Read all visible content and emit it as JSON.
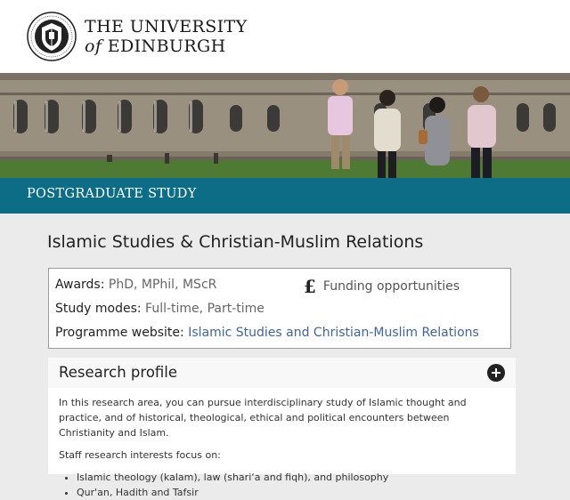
{
  "brand": {
    "line1": "THE UNIVERSITY",
    "line2_of": "of",
    "line2_rest": "EDINBURGH",
    "seal_text": "THE UNIVERSITY OF EDINBURGH"
  },
  "section": {
    "label": "POSTGRADUATE STUDY"
  },
  "page": {
    "title": "Islamic Studies & Christian-Muslim Relations"
  },
  "info": {
    "awards_label": "Awards:",
    "awards_value": "PhD, MPhil, MScR",
    "funding_symbol": "£",
    "funding_link": "Funding opportunities",
    "modes_label": "Study modes:",
    "modes_value": "Full-time, Part-time",
    "website_label": "Programme website:",
    "website_link": "Islamic Studies and Christian-Muslim Relations"
  },
  "research": {
    "title": "Research profile",
    "para1": "In this research area, you can pursue interdisciplinary study of Islamic thought and practice, and of historical, theological, ethical and political encounters between Christianity and Islam.",
    "para2": "Staff research interests focus on:",
    "items": [
      "Islamic theology (kalam), law (shari‘a and fiqh), and philosophy",
      "Qur'an, Hadith and Tafsir"
    ]
  },
  "colors": {
    "teal_bar": "#0e6d86",
    "link": "#3f63a8",
    "background": "#ebebeb"
  },
  "icons": {
    "seal": "university-crest-icon",
    "pound": "pound-icon",
    "expand": "plus-circle-icon"
  }
}
